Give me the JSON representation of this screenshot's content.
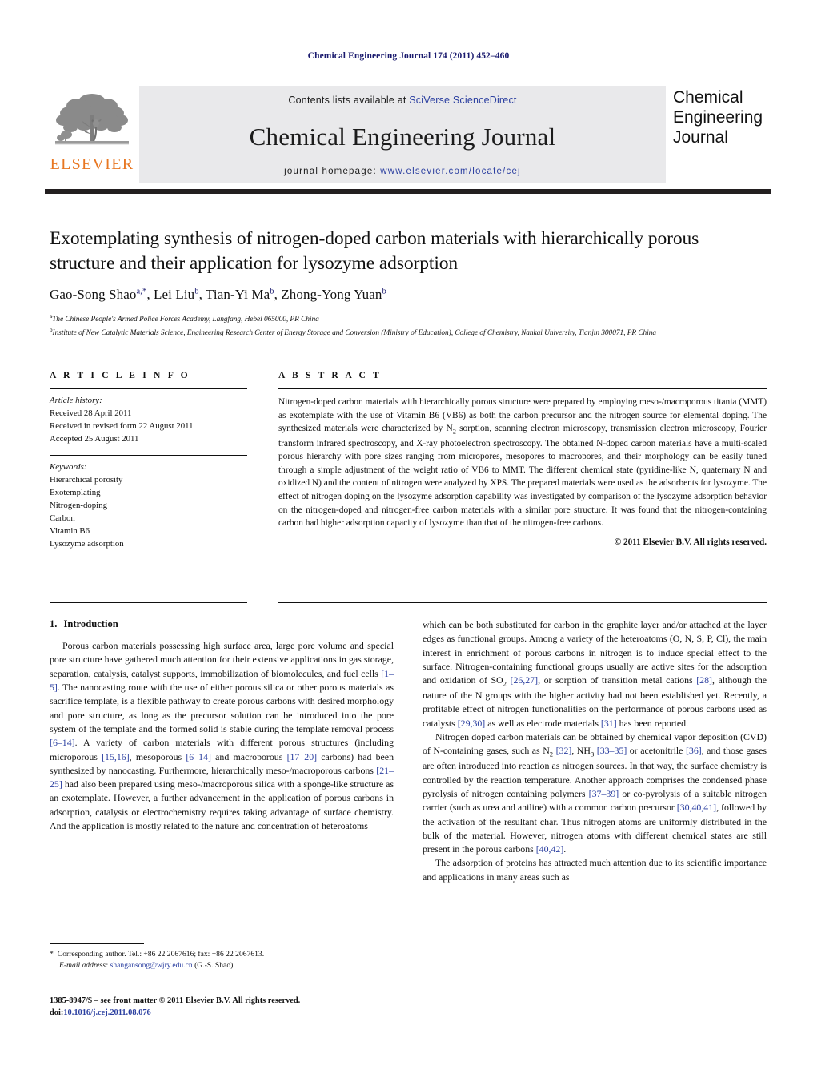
{
  "running_head": "Chemical Engineering Journal 174 (2011) 452–460",
  "masthead": {
    "publisher_name": "ELSEVIER",
    "contents_prefix": "Contents lists available at ",
    "contents_link": "SciVerse ScienceDirect",
    "journal_title": "Chemical Engineering Journal",
    "homepage_prefix": "journal homepage: ",
    "homepage_link": "www.elsevier.com/locate/cej",
    "cover_line1": "Chemical",
    "cover_line2": "Engineering",
    "cover_line3": "Journal"
  },
  "title": "Exotemplating synthesis of nitrogen-doped carbon materials with hierarchically porous structure and their application for lysozyme adsorption",
  "authors": [
    {
      "name": "Gao-Song Shao",
      "marks": "a,*"
    },
    {
      "name": "Lei Liu",
      "marks": "b"
    },
    {
      "name": "Tian-Yi Ma",
      "marks": "b"
    },
    {
      "name": "Zhong-Yong Yuan",
      "marks": "b"
    }
  ],
  "affiliations": [
    {
      "mark": "a",
      "text": "The Chinese People's Armed Police Forces Academy, Langfang, Hebei 065000, PR China"
    },
    {
      "mark": "b",
      "text": "Institute of New Catalytic Materials Science, Engineering Research Center of Energy Storage and Conversion (Ministry of Education), College of Chemistry, Nankai University, Tianjin 300071, PR China"
    }
  ],
  "article_info": {
    "label": "A R T I C L E   I N F O",
    "history_heading": "Article history:",
    "history": [
      "Received 28 April 2011",
      "Received in revised form 22 August 2011",
      "Accepted 25 August 2011"
    ],
    "keywords_heading": "Keywords:",
    "keywords": [
      "Hierarchical porosity",
      "Exotemplating",
      "Nitrogen-doping",
      "Carbon",
      "Vitamin B6",
      "Lysozyme adsorption"
    ]
  },
  "abstract": {
    "label": "A B S T R A C T",
    "text_part1": "Nitrogen-doped carbon materials with hierarchically porous structure were prepared by employing meso-/macroporous titania (MMT) as exotemplate with the use of Vitamin B6 (VB6) as both the carbon precursor and the nitrogen source for elemental doping. The synthesized materials were characterized by N",
    "subscript1": "2",
    "text_part2": " sorption, scanning electron microscopy, transmission electron microscopy, Fourier transform infrared spectroscopy, and X-ray photoelectron spectroscopy. The obtained N-doped carbon materials have a multi-scaled porous hierarchy with pore sizes ranging from micropores, mesopores to macropores, and their morphology can be easily tuned through a simple adjustment of the weight ratio of VB6 to MMT. The different chemical state (pyridine-like N, quaternary N and oxidized N) and the content of nitrogen were analyzed by XPS. The prepared materials were used as the adsorbents for lysozyme. The effect of nitrogen doping on the lysozyme adsorption capability was investigated by comparison of the lysozyme adsorption behavior on the nitrogen-doped and nitrogen-free carbon materials with a similar pore structure. It was found that the nitrogen-containing carbon had higher adsorption capacity of lysozyme than that of the nitrogen-free carbons.",
    "copyright": "© 2011 Elsevier B.V. All rights reserved."
  },
  "introduction": {
    "number": "1.",
    "heading": "Introduction",
    "para1_a": "Porous carbon materials possessing high surface area, large pore volume and special pore structure have gathered much attention for their extensive applications in gas storage, separation, catalysis, catalyst supports, immobilization of biomolecules, and fuel cells ",
    "ref1": "[1–5]",
    "para1_b": ". The nanocasting route with the use of either porous silica or other porous materials as sacrifice template, is a flexible pathway to create porous carbons with desired morphology and pore structure, as long as the precursor solution can be introduced into the pore system of the template and the formed solid is stable during the template removal process ",
    "ref2": "[6–14]",
    "para1_c": ". A variety of carbon materials with different porous structures (including microporous ",
    "ref3": "[15,16]",
    "para1_d": ", mesoporous ",
    "ref4": "[6–14]",
    "para1_e": " and macroporous ",
    "ref5": "[17–20]",
    "para1_f": " carbons) had been synthesized by nanocasting. Furthermore, hierarchically meso-/macroporous carbons ",
    "ref6": "[21–25]",
    "para1_g": " had also been prepared using meso-/macroporous silica with a sponge-like structure as an exotemplate. However, a further advancement in the application of porous carbons in adsorption, catalysis or electrochemistry requires taking advantage of surface chemistry. And the application is mostly related to the nature and concentration of heteroatoms",
    "para2_a": "which can be both substituted for carbon in the graphite layer and/or attached at the layer edges as functional groups. Among a variety of the heteroatoms (O, N, S, P, Cl), the main interest in enrichment of porous carbons in nitrogen is to induce special effect to the surface. Nitrogen-containing functional groups usually are active sites for the adsorption and oxidation of SO",
    "sub_so2": "2",
    "para2_b": " ",
    "ref7": "[26,27]",
    "para2_c": ", or sorption of transition metal cations ",
    "ref8": "[28]",
    "para2_d": ", although the nature of the N groups with the higher activity had not been established yet. Recently, a profitable effect of nitrogen functionalities on the performance of porous carbons used as catalysts ",
    "ref9": "[29,30]",
    "para2_e": " as well as electrode materials ",
    "ref10": "[31]",
    "para2_f": " has been reported.",
    "para3_a": "Nitrogen doped carbon materials can be obtained by chemical vapor deposition (CVD) of N-containing gases, such as N",
    "sub_n2": "2",
    "para3_b": " ",
    "ref11": "[32]",
    "para3_c": ", NH",
    "sub_nh3": "3",
    "para3_d": " ",
    "ref12": "[33–35]",
    "para3_e": " or acetonitrile ",
    "ref13": "[36]",
    "para3_f": ", and those gases are often introduced into reaction as nitrogen sources. In that way, the surface chemistry is controlled by the reaction temperature. Another approach comprises the condensed phase pyrolysis of nitrogen containing polymers ",
    "ref14": "[37–39]",
    "para3_g": " or co-pyrolysis of a suitable nitrogen carrier (such as urea and aniline) with a common carbon precursor ",
    "ref15": "[30,40,41]",
    "para3_h": ", followed by the activation of the resultant char. Thus nitrogen atoms are uniformly distributed in the bulk of the material. However, nitrogen atoms with different chemical states are still present in the porous carbons ",
    "ref16": "[40,42]",
    "para3_i": ".",
    "para4": "The adsorption of proteins has attracted much attention due to its scientific importance and applications in many areas such as"
  },
  "footnote": {
    "star": "*",
    "corresponding": "Corresponding author. Tel.: +86 22 2067616; fax: +86 22 2067613.",
    "email_label": "E-mail address:",
    "email": "shangansong@wjry.edu.cn",
    "email_owner": "(G.-S. Shao)."
  },
  "imprint": {
    "line1": "1385-8947/$ – see front matter © 2011 Elsevier B.V. All rights reserved.",
    "doi_label": "doi:",
    "doi_value": "10.1016/j.cej.2011.08.076"
  },
  "colors": {
    "link": "#2b3fa0",
    "running_head": "#1a1a6e",
    "elsevier_orange": "#E87722",
    "band_grey": "#e9e9eb",
    "rule_dark": "#231f20"
  }
}
